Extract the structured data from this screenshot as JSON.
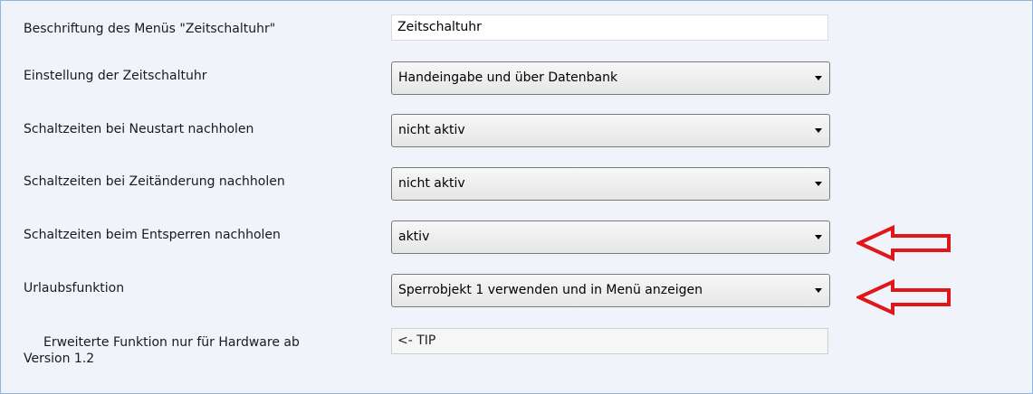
{
  "settings": {
    "rows": [
      {
        "label": "Beschriftung des Menüs \"Zeitschaltuhr\"",
        "value": "Zeitschaltuhr"
      },
      {
        "label": "Einstellung der Zeitschaltuhr",
        "value": "Handeingabe und über Datenbank"
      },
      {
        "label": "Schaltzeiten bei Neustart nachholen",
        "value": "nicht aktiv"
      },
      {
        "label": "Schaltzeiten bei Zeitänderung nachholen",
        "value": "nicht aktiv"
      },
      {
        "label": "Schaltzeiten beim Entsperren nachholen",
        "value": "aktiv"
      },
      {
        "label": "Urlaubsfunktion",
        "value": "Sperrobjekt 1 verwenden und in Menü anzeigen"
      }
    ],
    "extended": {
      "label_line1": "Erweiterte Funktion nur für Hardware ab",
      "label_line2": "Version 1.2",
      "value": "<- TIP"
    }
  },
  "annotations": {
    "arrow_color": "#e0161b",
    "icon": "left-arrow-icon"
  }
}
